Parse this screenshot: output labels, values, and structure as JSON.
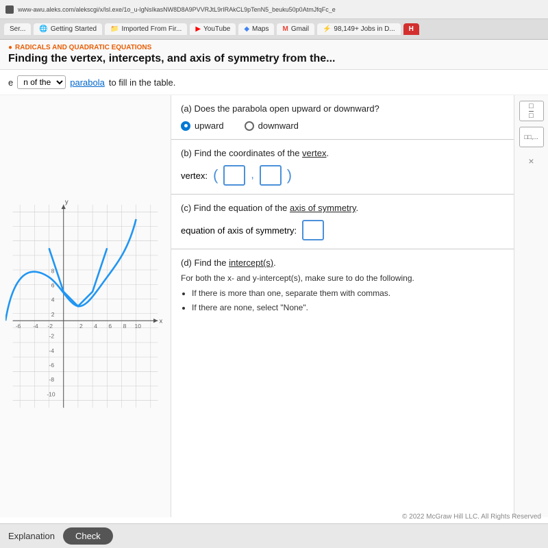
{
  "browser": {
    "url": "www-awu.aleks.com/alekscgi/x/lsl.exe/1o_u-lgNsIkasNW8D8A9PVVRJtL9rIRAkCL9pTenN5_beuku50p0AtmJfqFc_e",
    "favicon": "●"
  },
  "tabs": [
    {
      "id": "ser",
      "label": "Ser...",
      "icon": "",
      "active": false
    },
    {
      "id": "getting-started",
      "label": "Getting Started",
      "icon": "🌐",
      "active": false
    },
    {
      "id": "imported-from",
      "label": "Imported From Fir...",
      "icon": "📁",
      "active": false
    },
    {
      "id": "youtube",
      "label": "YouTube",
      "icon": "▶",
      "active": false
    },
    {
      "id": "maps",
      "label": "Maps",
      "icon": "◆",
      "active": false
    },
    {
      "id": "gmail",
      "label": "Gmail",
      "icon": "M",
      "active": false
    },
    {
      "id": "jobs",
      "label": "98,149+ Jobs in D...",
      "icon": "⚡",
      "active": false
    },
    {
      "id": "h",
      "label": "H",
      "icon": "",
      "active": false
    }
  ],
  "section": {
    "category": "RADICALS AND QUADRATIC EQUATIONS",
    "title": "Finding the vertex, intercepts, and axis of symmetry from the..."
  },
  "instruction": {
    "prefix": "e",
    "dropdown_label": "n of the",
    "link_text": "parabola",
    "suffix": "to fill in the table."
  },
  "questions": {
    "a": {
      "label": "(a) Does the parabola open upward or downward?",
      "option_upward": "upward",
      "option_downward": "downward",
      "selected": "upward"
    },
    "b": {
      "label": "(b) Find the coordinates of the vertex.",
      "vertex_label": "vertex:",
      "underline": "vertex"
    },
    "c": {
      "label": "(c) Find the equation of the axis of symmetry.",
      "eq_label": "equation of axis of symmetry:",
      "underline": "axis of symmetry"
    },
    "d": {
      "label": "(d) Find the intercept(s).",
      "body": "For both the x- and y-intercept(s), make sure to do the following.",
      "bullets": [
        "If there is more than one, separate them with commas.",
        "If there are none, select \"None\"."
      ],
      "underline": "intercept(s)"
    }
  },
  "sidebar": {
    "fraction_icon": "□/□",
    "dots_icon": "□□,...",
    "x_label": "×"
  },
  "bottom_bar": {
    "explanation_label": "Explanation",
    "check_label": "Check"
  },
  "footer": {
    "copyright": "© 2022 McGraw Hill LLC. All Rights Reserved"
  },
  "graph": {
    "x_min": -8,
    "x_max": 10,
    "y_min": -10,
    "y_max": 10,
    "vertex_x": 1,
    "vertex_y": 1,
    "y_label": "y",
    "x_label": "x"
  }
}
